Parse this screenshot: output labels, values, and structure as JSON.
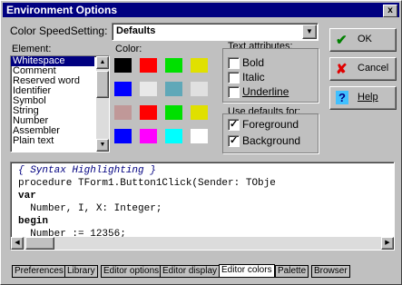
{
  "window": {
    "title": "Environment Options",
    "close_glyph": "x"
  },
  "color_speed": {
    "label": "Color SpeedSetting:",
    "value": "Defaults"
  },
  "element": {
    "label": "Element:",
    "items": [
      "Whitespace",
      "Comment",
      "Reserved word",
      "Identifier",
      "Symbol",
      "String",
      "Number",
      "Assembler",
      "Plain text"
    ],
    "selected": "Whitespace"
  },
  "color": {
    "label": "Color:",
    "swatches": [
      "#000000",
      "#ff0000",
      "#00e000",
      "#e0e000",
      "#0000ff",
      "#e8e8e8",
      "#60a8b8",
      "#e0e0e0",
      "#c09898",
      "#ff0000",
      "#00e000",
      "#e0e000",
      "#0000ff",
      "#ff00ff",
      "#00ffff",
      "#ffffff"
    ]
  },
  "text_attributes": {
    "title": "Text attributes:",
    "options": [
      {
        "label": "Bold",
        "checked": false
      },
      {
        "label": "Italic",
        "checked": false
      },
      {
        "label": "Underline",
        "checked": false
      }
    ]
  },
  "use_defaults": {
    "title": "Use defaults for:",
    "options": [
      {
        "label": "Foreground",
        "checked": true
      },
      {
        "label": "Background",
        "checked": true
      }
    ]
  },
  "buttons": {
    "ok": "OK",
    "cancel": "Cancel",
    "help": "Help"
  },
  "code_lines": [
    "{ Syntax Highlighting }",
    "procedure TForm1.Button1Click(Sender: TObje",
    "var",
    "  Number, I, X: Integer;",
    "begin",
    "  Number := 12356;"
  ],
  "tabs": [
    "Preferences",
    "Library",
    "Editor options",
    "Editor display",
    "Editor colors",
    "Palette",
    "Browser"
  ],
  "active_tab": "Editor colors"
}
